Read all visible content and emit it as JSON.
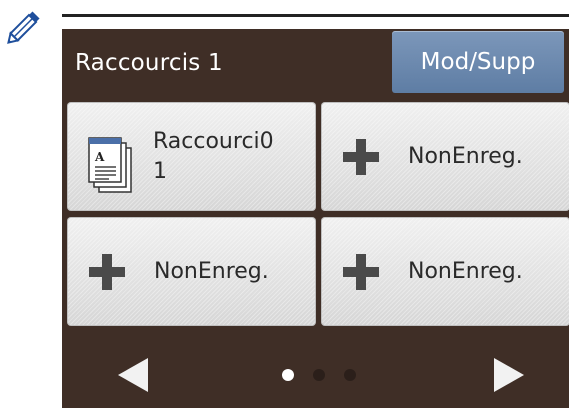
{
  "header": {
    "title": "Raccourcis 1",
    "mod_button_label": "Mod/Supp"
  },
  "tiles": [
    {
      "label_line1": "Raccourci0",
      "label_line2": "1",
      "icon": "document-icon",
      "registered": true
    },
    {
      "label": "NonEnreg.",
      "icon": "plus-icon",
      "registered": false
    },
    {
      "label": "NonEnreg.",
      "icon": "plus-icon",
      "registered": false
    },
    {
      "label": "NonEnreg.",
      "icon": "plus-icon",
      "registered": false
    }
  ],
  "pagination": {
    "current_page": 1,
    "page_count": 3
  },
  "icons": {
    "top_left": "pencil-icon",
    "prev": "left-arrow-icon",
    "next": "right-arrow-icon"
  },
  "colors": {
    "panel": "#3f2e26",
    "button_blue": "#6886ad",
    "tile": "#e3e3e3",
    "dot_active": "#ffffff",
    "dot_inactive": "#2b1f1a"
  }
}
